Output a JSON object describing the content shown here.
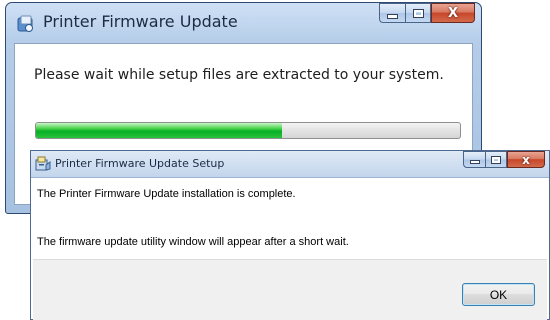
{
  "back_window": {
    "title": "Printer Firmware Update",
    "message": "Please wait while setup files are extracted to your system.",
    "progress_fraction": 0.58,
    "close_glyph": "X"
  },
  "dialog": {
    "title": "Printer Firmware Update Setup",
    "line1": "The Printer Firmware Update installation is complete.",
    "line2": "The firmware update utility window will appear after a short wait.",
    "ok_label": "OK",
    "close_glyph": "x"
  }
}
